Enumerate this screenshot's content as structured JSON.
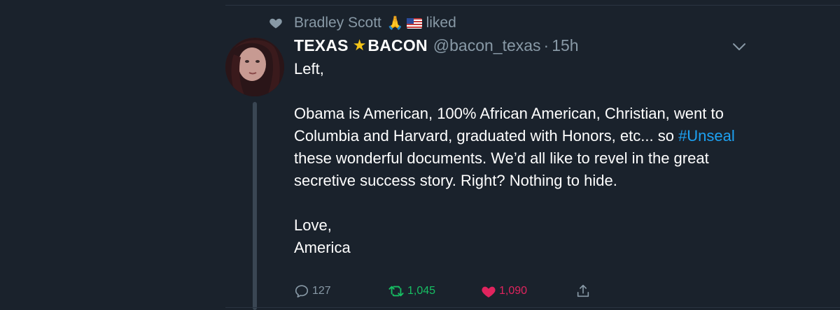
{
  "social_context": {
    "user": "Bradley Scott",
    "action": "liked",
    "icon": "heart-icon"
  },
  "tweet": {
    "display_name_1": "TEXAS",
    "display_name_2": "BACON",
    "handle": "@bacon_texas",
    "separator": "·",
    "time": "15h",
    "greeting": "Left,",
    "para_before_hashtag": "Obama is American, 100% African American, Christian, went to Columbia and Harvard, graduated with Honors, etc... so ",
    "hashtag": "#Unseal",
    "para_after_hashtag": " these wonderful documents. We’d all like to revel in the great secretive success story. Right? Nothing to hide.",
    "signoff_1": "Love,",
    "signoff_2": "America"
  },
  "actions": {
    "reply_count": "127",
    "retweet_count": "1,045",
    "like_count": "1,090"
  },
  "colors": {
    "background": "#1a222c",
    "secondary_text": "#8899a6",
    "link": "#1da1f2",
    "retweet_active": "#17bf63",
    "like_active": "#e0245e"
  }
}
